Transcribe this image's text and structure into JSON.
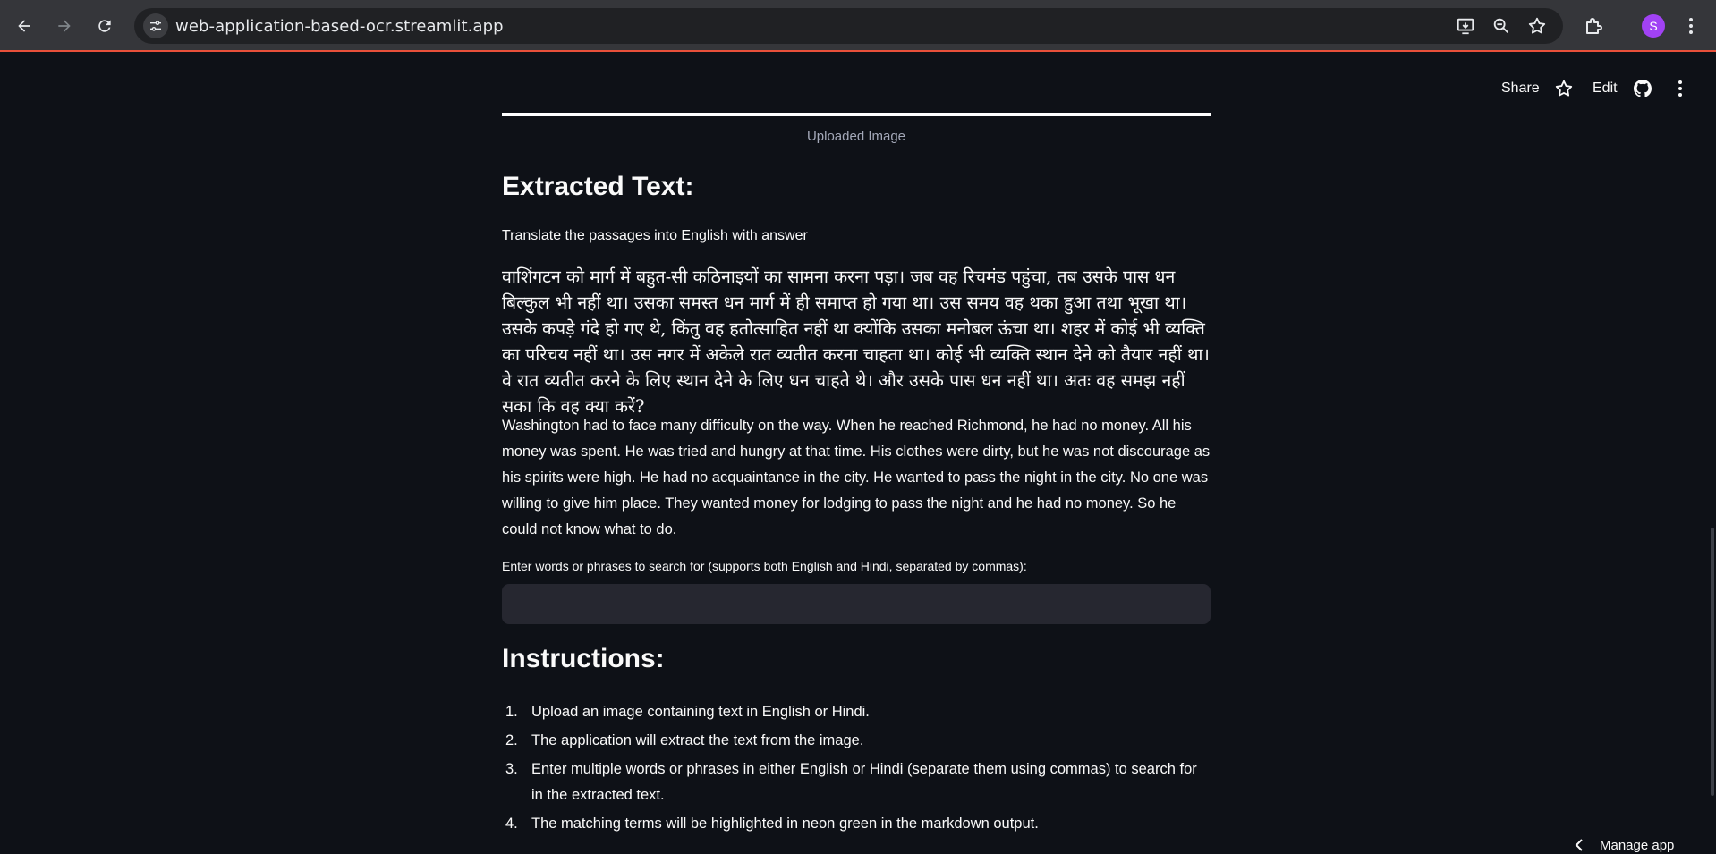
{
  "browser": {
    "url": "web-application-based-ocr.streamlit.app",
    "profile_initial": "S"
  },
  "header": {
    "share": "Share",
    "edit": "Edit"
  },
  "image": {
    "caption": "Uploaded Image"
  },
  "extracted": {
    "heading": "Extracted Text:",
    "line1": "Translate the passages into English with answer",
    "hindi": "वाशिंगटन को मार्ग में बहुत-सी कठिनाइयों का सामना करना पड़ा। जब वह रिचमंड पहुंचा, तब उसके पास धन बिल्कुल भी नहीं था। उसका समस्त धन मार्ग में ही समाप्त हो गया था। उस समय वह थका हुआ तथा भूखा था। उसके कपड़े गंदे हो गए थे, किंतु वह हतोत्साहित नहीं था क्योंकि उसका मनोबल ऊंचा था। शहर में कोई भी व्यक्ति का परिचय नहीं था। उस नगर में अकेले रात व्यतीत करना चाहता था। कोई भी व्यक्ति स्थान देने को तैयार नहीं था। वे रात व्यतीत करने के लिए स्थान देने के लिए धन चाहते थे। और उसके पास धन नहीं था। अतः वह समझ नहीं सका कि वह क्या करें?",
    "english": "Washington had to face many difficulty on the way. When he reached Richmond, he had no money. All his money was spent. He was tried and hungry at that time. His clothes were dirty, but he was not discourage as his spirits were high. He had no acquaintance in the city. He wanted to pass the night in the city. No one was willing to give him place. They wanted money for lodging to pass the night and he had no money. So he could not know what to do."
  },
  "search": {
    "label": "Enter words or phrases to search for (supports both English and Hindi, separated by commas):",
    "value": ""
  },
  "instructions": {
    "heading": "Instructions:",
    "items": [
      {
        "num": "1.",
        "text": "Upload an image containing text in English or Hindi."
      },
      {
        "num": "2.",
        "text": "The application will extract the text from the image."
      },
      {
        "num": "3.",
        "text": "Enter multiple words or phrases in either English or Hindi (separate them using commas) to search for in the extracted text."
      },
      {
        "num": "4.",
        "text": "The matching terms will be highlighted in neon green in the markdown output."
      }
    ]
  },
  "footer": {
    "manage_app": "Manage app"
  },
  "icons": {
    "back": "arrow-left-icon",
    "forward": "arrow-right-icon",
    "reload": "reload-icon",
    "site_info": "tune-icon",
    "install": "install-app-icon",
    "zoom": "zoom-icon",
    "bookmark": "star-icon",
    "extensions": "puzzle-icon",
    "menu": "kebab-menu-icon",
    "github": "github-icon"
  },
  "colors": {
    "background": "#0e1117",
    "input_bg": "#262730",
    "text": "#fafafa",
    "caption": "#a3a8b8",
    "avatar": "#a142f4"
  }
}
